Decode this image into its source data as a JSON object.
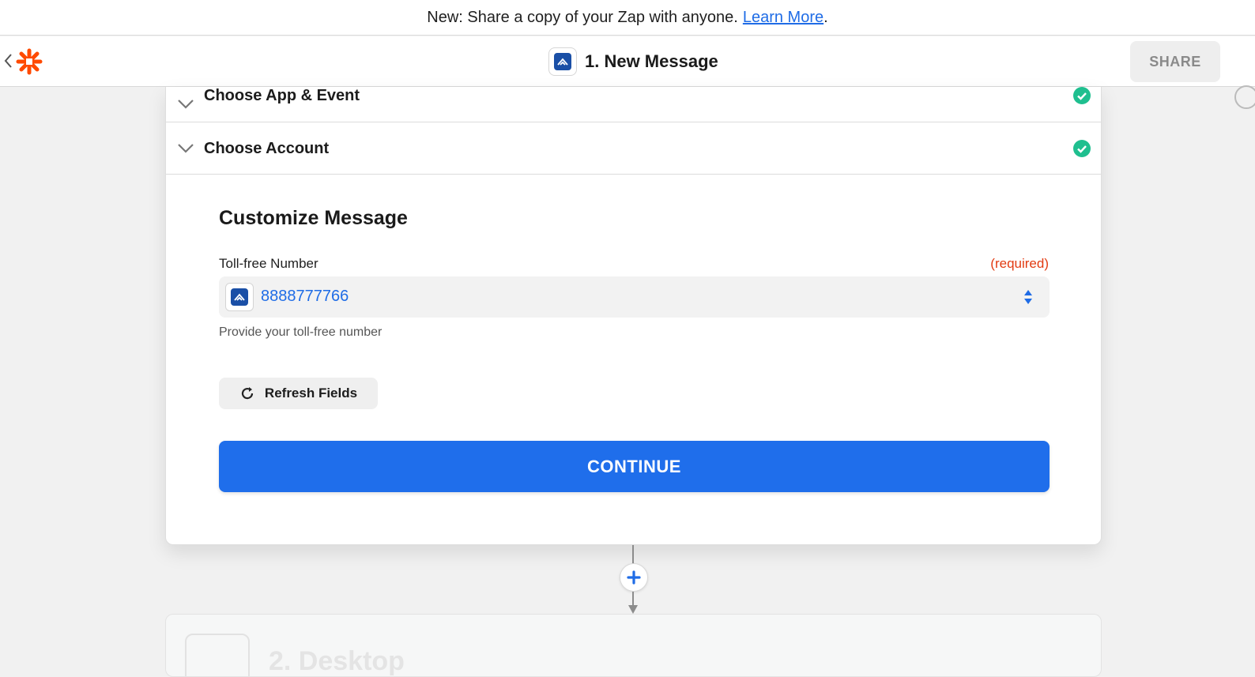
{
  "banner": {
    "text": "New: Share a copy of your Zap with anyone.",
    "link_text": "Learn More",
    "trailing": "."
  },
  "header": {
    "back_icon": "chevron-left-icon",
    "logo_icon": "zapier-logo-icon",
    "step_title": "1. New Message",
    "share_label": "SHARE"
  },
  "steps": [
    {
      "label": "Choose App & Event",
      "status": "complete"
    },
    {
      "label": "Choose Account",
      "status": "complete"
    }
  ],
  "customize": {
    "title": "Customize Message",
    "field_label": "Toll-free Number",
    "required_label": "(required)",
    "field_value": "8888777766",
    "help_text": "Provide your toll-free number",
    "refresh_label": "Refresh Fields",
    "continue_label": "CONTINUE"
  },
  "next_step": {
    "title_partial": "2. Desktop"
  },
  "colors": {
    "accent": "#1f6eeb",
    "success": "#1fbf8f",
    "required": "#e23b12",
    "brand": "#ff4a00"
  }
}
